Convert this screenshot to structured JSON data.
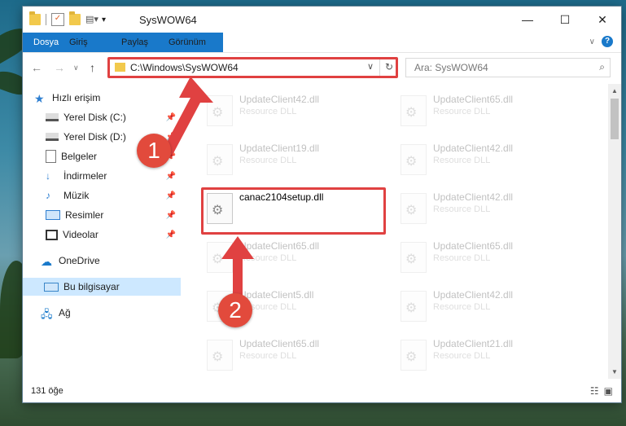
{
  "window": {
    "title": "SysWOW64",
    "controls": {
      "minimize": "—",
      "maximize": "☐",
      "close": "✕"
    }
  },
  "ribbon": {
    "tabs": [
      "Dosya",
      "Giriş",
      "Paylaş",
      "Görünüm"
    ],
    "help": "?"
  },
  "address": {
    "path": "C:\\Windows\\SysWOW64",
    "search_placeholder": "Ara: SysWOW64"
  },
  "sidebar": {
    "items": [
      {
        "label": "Hızlı erişim",
        "icon": "star-icon"
      },
      {
        "label": "Yerel Disk (C:)",
        "icon": "drive-icon",
        "pinned": true
      },
      {
        "label": "Yerel Disk (D:)",
        "icon": "drive-icon",
        "pinned": true
      },
      {
        "label": "Belgeler",
        "icon": "documents-icon",
        "pinned": true
      },
      {
        "label": "İndirmeler",
        "icon": "downloads-icon",
        "pinned": true
      },
      {
        "label": "Müzik",
        "icon": "music-icon",
        "pinned": true
      },
      {
        "label": "Resimler",
        "icon": "pictures-icon",
        "pinned": true
      },
      {
        "label": "Videolar",
        "icon": "videos-icon",
        "pinned": true
      },
      {
        "label": "OneDrive",
        "icon": "cloud-icon"
      },
      {
        "label": "Bu bilgisayar",
        "icon": "computer-icon",
        "selected": true
      },
      {
        "label": "Ağ",
        "icon": "network-icon"
      }
    ]
  },
  "files": {
    "left": [
      {
        "name": "UpdateClient42.dll",
        "type": "Resource DLL"
      },
      {
        "name": "UpdateClient19.dll",
        "type": "Resource DLL"
      },
      {
        "name": "canac2104setup.dll",
        "type": ""
      },
      {
        "name": "UpdateClient65.dll",
        "type": "Resource DLL"
      },
      {
        "name": "UpdateClient5.dll",
        "type": "Resource DLL"
      },
      {
        "name": "UpdateClient65.dll",
        "type": "Resource DLL"
      }
    ],
    "right": [
      {
        "name": "UpdateClient65.dll",
        "type": "Resource DLL"
      },
      {
        "name": "UpdateClient42.dll",
        "type": "Resource DLL"
      },
      {
        "name": "UpdateClient42.dll",
        "type": "Resource DLL"
      },
      {
        "name": "UpdateClient65.dll",
        "type": "Resource DLL"
      },
      {
        "name": "UpdateClient42.dll",
        "type": "Resource DLL"
      },
      {
        "name": "UpdateClient21.dll",
        "type": "Resource DLL"
      }
    ]
  },
  "status": {
    "count": "131 öğe"
  },
  "annotations": {
    "badge1": "1",
    "badge2": "2",
    "color": "#e04141"
  }
}
